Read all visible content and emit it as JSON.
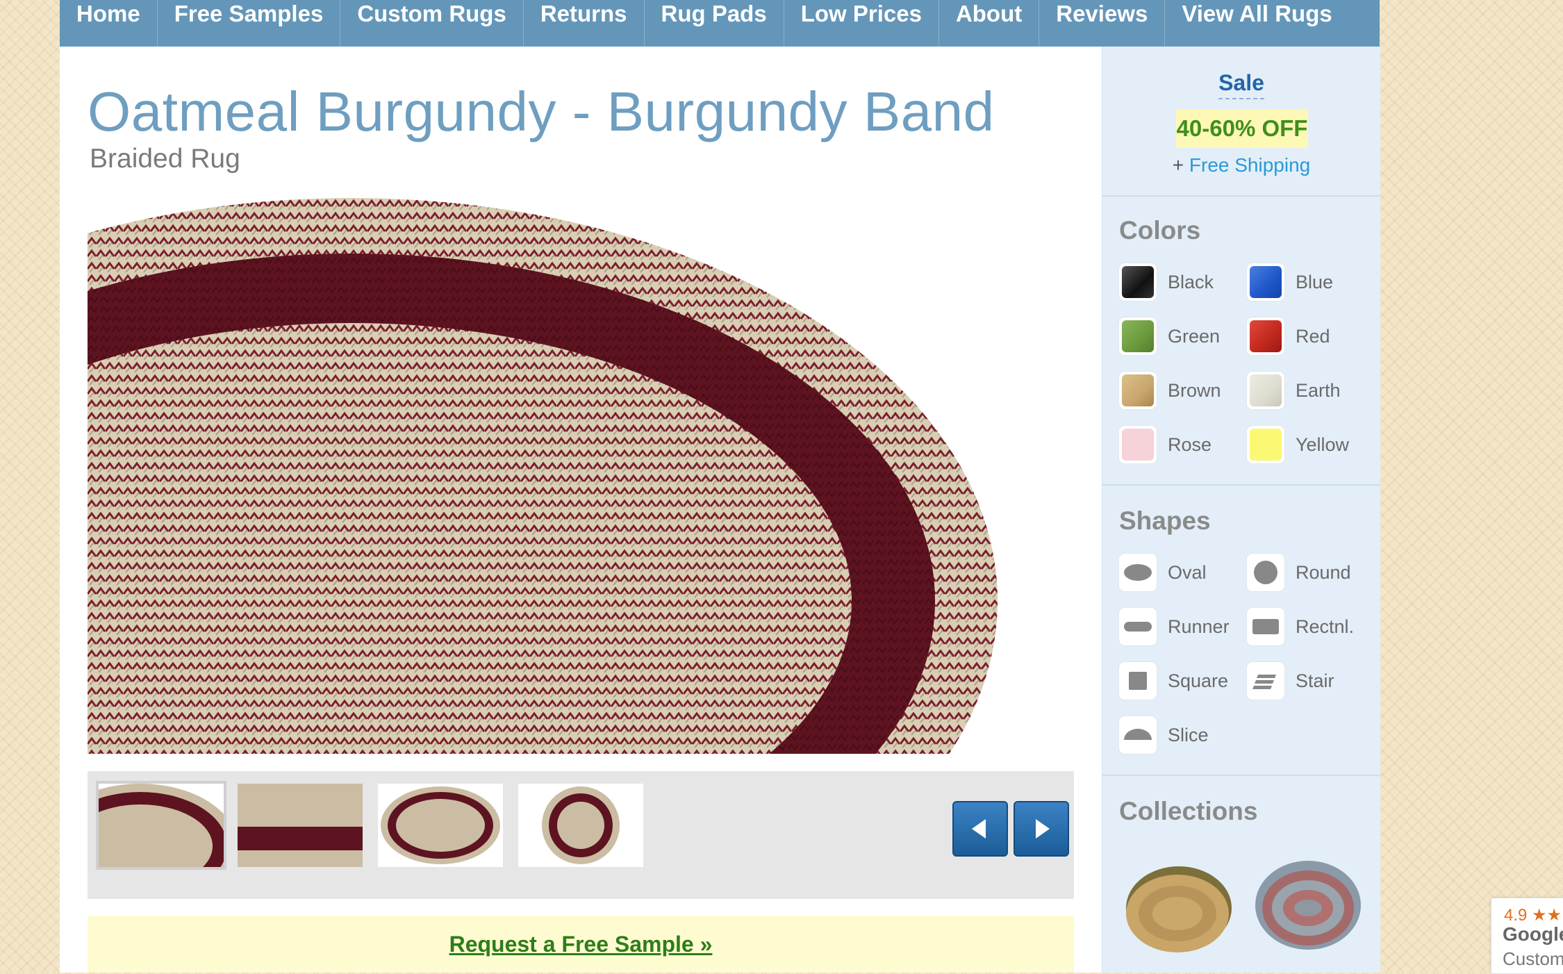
{
  "nav": {
    "items": [
      "Home",
      "Free Samples",
      "Custom Rugs",
      "Returns",
      "Rug Pads",
      "Low Prices",
      "About",
      "Reviews",
      "View All Rugs"
    ]
  },
  "product": {
    "title": "Oatmeal Burgundy - Burgundy Band",
    "subtitle": "Braided Rug",
    "main_image_icon": "braided-oval-rug-image",
    "thumbnails": [
      "rug-oval-corner-thumbnail",
      "rug-band-closeup-thumbnail",
      "rug-oval-thumbnail",
      "rug-round-thumbnail"
    ],
    "active_thumbnail": 0,
    "prev_icon": "arrow-left-icon",
    "next_icon": "arrow-right-icon",
    "sample_link": "Request a Free Sample »"
  },
  "sidebar": {
    "sale": {
      "title": "Sale",
      "discount": "40-60% OFF",
      "shipping_prefix": "+ ",
      "shipping_link": "Free Shipping"
    },
    "colors": {
      "heading": "Colors",
      "items": [
        {
          "label": "Black",
          "color": "#1a1a1a"
        },
        {
          "label": "Blue",
          "color": "#1e56c8"
        },
        {
          "label": "Green",
          "color": "#6a9a3c"
        },
        {
          "label": "Red",
          "color": "#c0271d"
        },
        {
          "label": "Brown",
          "color": "#c8a66c"
        },
        {
          "label": "Earth",
          "color": "#dcdcd0"
        },
        {
          "label": "Rose",
          "color": "#f6d3d8"
        },
        {
          "label": "Yellow",
          "color": "#fbf874"
        }
      ]
    },
    "shapes": {
      "heading": "Shapes",
      "items": [
        {
          "label": "Oval",
          "icon": "oval-shape-icon"
        },
        {
          "label": "Round",
          "icon": "round-shape-icon"
        },
        {
          "label": "Runner",
          "icon": "runner-shape-icon"
        },
        {
          "label": "Rectnl.",
          "icon": "rectangle-shape-icon"
        },
        {
          "label": "Square",
          "icon": "square-shape-icon"
        },
        {
          "label": "Stair",
          "icon": "stair-shape-icon"
        },
        {
          "label": "Slice",
          "icon": "slice-shape-icon"
        }
      ]
    },
    "collections": {
      "heading": "Collections",
      "images": [
        "country-braided-rug-collection-image",
        "wool-braided-rug-collection-image"
      ]
    }
  },
  "review_badge": {
    "rating": "4.9 ★★",
    "brand": "Google",
    "caption": "Custom"
  },
  "colors": {
    "nav_bg": "#6496b9",
    "title": "#6e9ec0",
    "sidebar_bg": "#e3eef8",
    "sale_text": "#2464a8",
    "discount_text": "#3e8f1b",
    "sample_bar_bg": "#fefbd0",
    "rug_burgundy": "#5e1320",
    "rug_oatmeal": "#d9ceb4"
  }
}
